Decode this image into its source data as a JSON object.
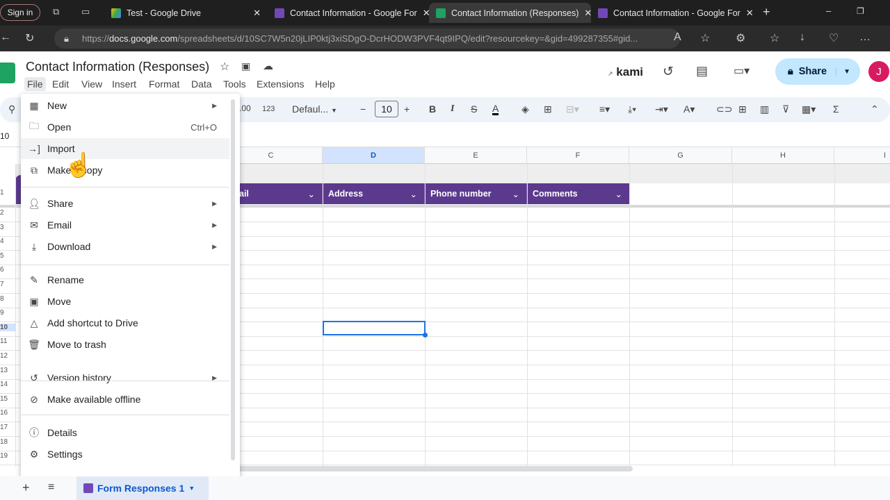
{
  "browser": {
    "signin": "Sign in",
    "tabs": [
      {
        "title": "Test - Google Drive",
        "icon": "drive-icon"
      },
      {
        "title": "Contact Information - Google For",
        "icon": "forms-icon"
      },
      {
        "title": "Contact Information (Responses)",
        "icon": "sheets-icon",
        "active": true
      },
      {
        "title": "Contact Information - Google For",
        "icon": "forms-icon"
      }
    ],
    "url_prefix": "https://",
    "url_domain": "docs.google.com",
    "url_rest": "/spreadsheets/d/10SC7W5n20jLIP0ktj3xiSDgO-DcrHODW3PVF4qt9IPQ/edit?resourcekey=&gid=499287355#gid..."
  },
  "app": {
    "title": "Contact Information (Responses)",
    "menus": [
      "File",
      "Edit",
      "View",
      "Insert",
      "Format",
      "Data",
      "Tools",
      "Extensions",
      "Help"
    ],
    "kami": "kami",
    "share": "Share",
    "avatar": "J",
    "accent": "#5b3a8e"
  },
  "toolbar": {
    "decimal": ".00",
    "format123": "123",
    "font": "Defaul...",
    "font_size": "10",
    "bold": "B",
    "italic": "I"
  },
  "formula": {
    "cell_ref": "10"
  },
  "grid": {
    "columns": [
      "C",
      "D",
      "E",
      "F",
      "G",
      "H",
      "I"
    ],
    "selected_column": "D",
    "headers": [
      "ail",
      "Address",
      "Phone number",
      "Comments"
    ],
    "rows": [
      "1",
      "2",
      "3",
      "4",
      "5",
      "6",
      "7",
      "8",
      "9",
      "10",
      "11",
      "12",
      "13",
      "14",
      "15",
      "16",
      "17",
      "18",
      "19"
    ],
    "selected_row": "10"
  },
  "file_menu": {
    "items": [
      {
        "label": "New",
        "icon": "new-sheet-icon",
        "submenu": true
      },
      {
        "label": "Open",
        "icon": "folder-icon",
        "shortcut": "Ctrl+O"
      },
      {
        "label": "Import",
        "icon": "import-icon"
      },
      {
        "label": "Make a copy",
        "icon": "copy-icon"
      },
      {
        "label": "Share",
        "icon": "share-person-icon",
        "submenu": true
      },
      {
        "label": "Email",
        "icon": "email-icon",
        "submenu": true
      },
      {
        "label": "Download",
        "icon": "download-icon",
        "submenu": true
      },
      {
        "label": "Rename",
        "icon": "rename-icon"
      },
      {
        "label": "Move",
        "icon": "move-folder-icon"
      },
      {
        "label": "Add shortcut to Drive",
        "icon": "drive-shortcut-icon"
      },
      {
        "label": "Move to trash",
        "icon": "trash-icon"
      },
      {
        "label": "Version history",
        "icon": "history-icon",
        "submenu": true
      },
      {
        "label": "Make available offline",
        "icon": "offline-icon"
      },
      {
        "label": "Details",
        "icon": "info-icon"
      },
      {
        "label": "Settings",
        "icon": "gear-icon"
      }
    ]
  },
  "sheet_tab": {
    "label": "Form Responses 1"
  }
}
